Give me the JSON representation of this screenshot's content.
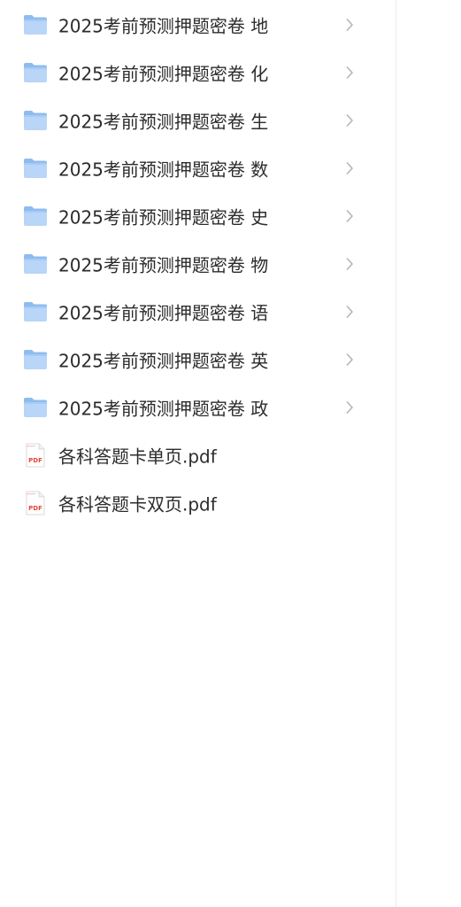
{
  "items": [
    {
      "name": "2025考前预测押题密卷 地",
      "type": "folder"
    },
    {
      "name": "2025考前预测押题密卷 化",
      "type": "folder"
    },
    {
      "name": "2025考前预测押题密卷 生",
      "type": "folder"
    },
    {
      "name": "2025考前预测押题密卷 数",
      "type": "folder"
    },
    {
      "name": "2025考前预测押题密卷 史",
      "type": "folder"
    },
    {
      "name": "2025考前预测押题密卷 物",
      "type": "folder"
    },
    {
      "name": "2025考前预测押题密卷 语",
      "type": "folder"
    },
    {
      "name": "2025考前预测押题密卷 英",
      "type": "folder"
    },
    {
      "name": "2025考前预测押题密卷 政",
      "type": "folder"
    },
    {
      "name": "各科答题卡单页.pdf",
      "type": "pdf",
      "icon_text": "PDF"
    },
    {
      "name": "各科答题卡双页.pdf",
      "type": "pdf",
      "icon_text": "PDF"
    }
  ],
  "colors": {
    "folder_light": "#b9d5f7",
    "folder_dark": "#8ebcf0",
    "pdf_red": "#e0463a",
    "chevron": "#b5b5b5",
    "text": "#2c2c2c"
  },
  "icons": {
    "folder": "folder-icon",
    "pdf": "pdf-file-icon",
    "chevron": "chevron-right-icon"
  }
}
